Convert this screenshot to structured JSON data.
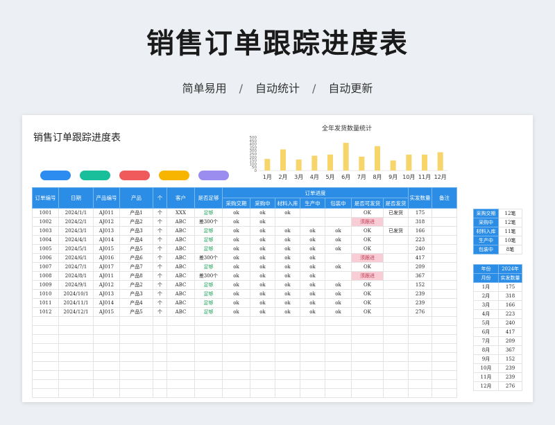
{
  "hero": {
    "title": "销售订单跟踪进度表",
    "subtitle": [
      "简单易用",
      "自动统计",
      "自动更新"
    ],
    "separator": "/"
  },
  "sheet": {
    "title": "销售订单跟踪进度表",
    "pill_colors": [
      "#2d8cf0",
      "#19be9b",
      "#f05a5a",
      "#f7b500",
      "#9b8cf0"
    ]
  },
  "chart_data": {
    "type": "bar",
    "title": "全年发货数量统计",
    "categories": [
      "1月",
      "2月",
      "3月",
      "4月",
      "5月",
      "6月",
      "7月",
      "8月",
      "9月",
      "10月",
      "11月",
      "12月"
    ],
    "values": [
      175,
      318,
      166,
      223,
      240,
      417,
      209,
      367,
      152,
      239,
      239,
      276
    ],
    "yticks": [
      0,
      50,
      100,
      150,
      200,
      250,
      300,
      350,
      400,
      450,
      500
    ],
    "ylim": [
      0,
      500
    ],
    "color": "#f7d56a"
  },
  "table": {
    "headers": {
      "order_no": "订单编号",
      "date": "日期",
      "product_no": "产品编号",
      "product": "产品",
      "unit": "个",
      "customer": "客户",
      "enough": "是否足够",
      "progress_group": "订单进度",
      "progress": [
        "采购交期",
        "采购中",
        "材料入库",
        "生产中",
        "包装中",
        "是否可发货",
        "是否发货"
      ],
      "shipped_qty": "实发数量",
      "remark": "备注"
    },
    "rows": [
      [
        "1001",
        "2024/1/1",
        "AJ011",
        "产品1",
        "个",
        "XXX",
        "足够",
        "ok",
        "ok",
        "ok",
        "",
        "",
        "OK",
        "已发货",
        "175",
        ""
      ],
      [
        "1002",
        "2024/2/1",
        "AJ012",
        "产品2",
        "个",
        "ABC",
        "差300个",
        "ok",
        "ok",
        "",
        "",
        "",
        "须跟进",
        "",
        "318",
        ""
      ],
      [
        "1003",
        "2024/3/1",
        "AJ013",
        "产品3",
        "个",
        "ABC",
        "足够",
        "ok",
        "ok",
        "ok",
        "ok",
        "ok",
        "OK",
        "已发货",
        "166",
        ""
      ],
      [
        "1004",
        "2024/4/1",
        "AJ014",
        "产品4",
        "个",
        "ABC",
        "足够",
        "ok",
        "ok",
        "ok",
        "ok",
        "ok",
        "OK",
        "",
        "223",
        ""
      ],
      [
        "1005",
        "2024/5/1",
        "AJ015",
        "产品5",
        "个",
        "ABC",
        "足够",
        "ok",
        "ok",
        "ok",
        "ok",
        "ok",
        "OK",
        "",
        "240",
        ""
      ],
      [
        "1006",
        "2024/6/1",
        "AJ016",
        "产品6",
        "个",
        "ABC",
        "差300个",
        "ok",
        "ok",
        "ok",
        "ok",
        "",
        "须跟进",
        "",
        "417",
        ""
      ],
      [
        "1007",
        "2024/7/1",
        "AJ017",
        "产品7",
        "个",
        "ABC",
        "足够",
        "ok",
        "ok",
        "ok",
        "ok",
        "ok",
        "OK",
        "",
        "209",
        ""
      ],
      [
        "1008",
        "2024/8/1",
        "AJ011",
        "产品8",
        "个",
        "ABC",
        "差300个",
        "ok",
        "ok",
        "ok",
        "ok",
        "",
        "须跟进",
        "",
        "367",
        ""
      ],
      [
        "1009",
        "2024/9/1",
        "AJ012",
        "产品2",
        "个",
        "ABC",
        "足够",
        "ok",
        "ok",
        "ok",
        "ok",
        "ok",
        "OK",
        "",
        "152",
        ""
      ],
      [
        "1010",
        "2024/10/1",
        "AJ013",
        "产品3",
        "个",
        "ABC",
        "足够",
        "ok",
        "ok",
        "ok",
        "ok",
        "ok",
        "OK",
        "",
        "239",
        ""
      ],
      [
        "1011",
        "2024/11/1",
        "AJ014",
        "产品4",
        "个",
        "ABC",
        "足够",
        "ok",
        "ok",
        "ok",
        "ok",
        "ok",
        "OK",
        "",
        "239",
        ""
      ],
      [
        "1012",
        "2024/12/1",
        "AJ015",
        "产品5",
        "个",
        "ABC",
        "足够",
        "ok",
        "ok",
        "ok",
        "ok",
        "ok",
        "OK",
        "",
        "276",
        ""
      ]
    ],
    "empty_rows": 9
  },
  "status_summary": [
    {
      "label": "采购交期",
      "value": "12笔"
    },
    {
      "label": "采购中",
      "value": "12笔"
    },
    {
      "label": "材料入库",
      "value": "11笔"
    },
    {
      "label": "生产中",
      "value": "10笔"
    },
    {
      "label": "包装中",
      "value": "8笔"
    }
  ],
  "monthly": {
    "year_label": "年份",
    "year_value": "2024年",
    "month_label": "月份",
    "qty_label": "实发数量",
    "rows": [
      [
        "1月",
        "175"
      ],
      [
        "2月",
        "318"
      ],
      [
        "3月",
        "166"
      ],
      [
        "4月",
        "223"
      ],
      [
        "5月",
        "240"
      ],
      [
        "6月",
        "417"
      ],
      [
        "7月",
        "209"
      ],
      [
        "8月",
        "367"
      ],
      [
        "9月",
        "152"
      ],
      [
        "10月",
        "239"
      ],
      [
        "11月",
        "239"
      ],
      [
        "12月",
        "276"
      ]
    ]
  }
}
